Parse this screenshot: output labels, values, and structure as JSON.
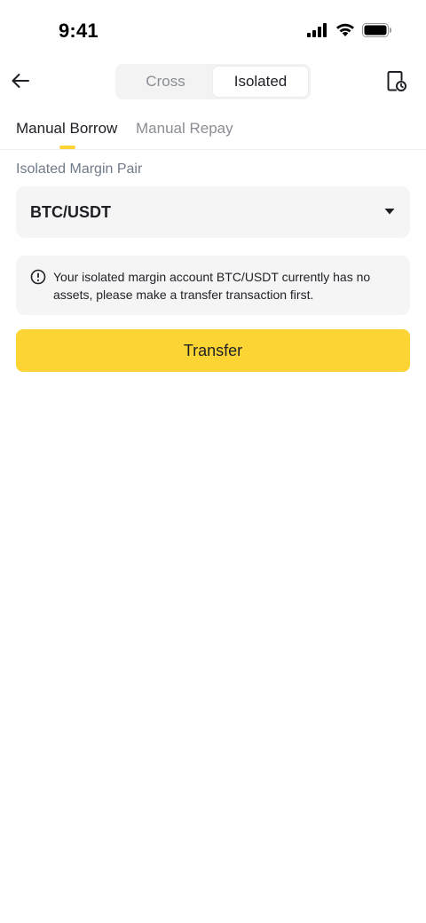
{
  "status_bar": {
    "time": "9:41"
  },
  "header": {
    "back_icon": "arrow-left-icon",
    "segments": [
      {
        "label": "Cross",
        "active": false
      },
      {
        "label": "Isolated",
        "active": true
      }
    ],
    "history_icon": "document-clock-icon"
  },
  "subtabs": [
    {
      "label": "Manual Borrow",
      "active": true
    },
    {
      "label": "Manual Repay",
      "active": false
    }
  ],
  "form": {
    "pair_label": "Isolated Margin Pair",
    "pair_value": "BTC/USDT",
    "dropdown_icon": "caret-down-icon",
    "notice_icon": "info-circle-icon",
    "notice_text": "Your isolated margin account BTC/USDT currently has no assets, please make a transfer transaction first.",
    "transfer_label": "Transfer"
  },
  "colors": {
    "accent": "#fcd535",
    "text_primary": "#1e2026",
    "text_secondary": "#707a8a",
    "surface": "#f5f5f5"
  }
}
